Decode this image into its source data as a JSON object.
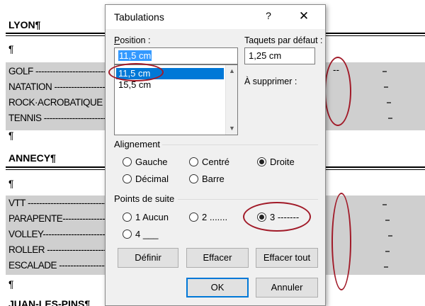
{
  "document": {
    "heading_lyon": "LYON¶",
    "heading_annecy": "ANNECY¶",
    "heading_juan": "JUAN-LES-PINS¶",
    "pilcrow": "¶",
    "lyon_rows": [
      "GOLF ------------------------------",
      "NATATION ----------------------------",
      "ROCK·ACROBATIQUE",
      "TENNIS -----------------------------"
    ],
    "annecy_rows": [
      "VTT -----------------------------------",
      "PARAPENTE---------------------------",
      "VOLLEY--------------------------------",
      "ROLLER --------------------------------",
      "ESCALADE ----------------------------"
    ],
    "right_dashes": "--",
    "highlight_color": "#a11a28"
  },
  "dialog": {
    "title": "Tabulations",
    "help": "?",
    "close": "✕",
    "position_label": "Position :",
    "position_value": "11,5 cm",
    "tab_positions": [
      "11,5 cm",
      "15,5 cm"
    ],
    "default_stops_label": "Taquets par défaut :",
    "default_stops_value": "1,25 cm",
    "to_clear_label": "À supprimer :",
    "alignment": {
      "title": "Alignement",
      "options": [
        "Gauche",
        "Centré",
        "Droite",
        "Décimal",
        "Barre"
      ],
      "selected": "Droite"
    },
    "leader": {
      "title": "Points de suite",
      "options": [
        "1 Aucun",
        "2 .......",
        "3 -------",
        "4 ___"
      ],
      "selected": "3 -------"
    },
    "buttons": {
      "set": "Définir",
      "clear": "Effacer",
      "clear_all": "Effacer tout",
      "ok": "OK",
      "cancel": "Annuler"
    },
    "accent_color": "#0078d7"
  }
}
